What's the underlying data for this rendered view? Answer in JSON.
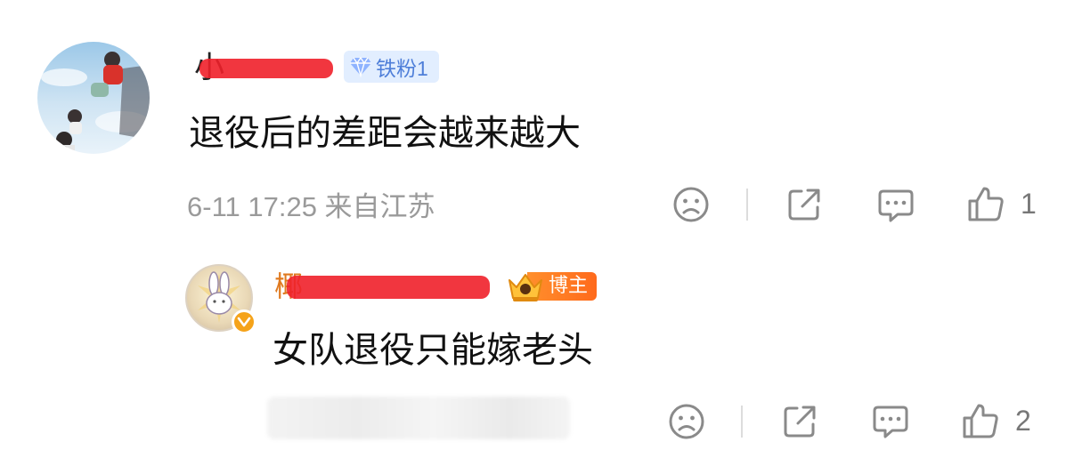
{
  "comment": {
    "username": "小",
    "fan_badge": "铁粉1",
    "content": "退役后的差距会越来越大",
    "meta": "6-11 17:25  来自江苏",
    "likes": "1"
  },
  "reply": {
    "username": "椰",
    "blogger_badge": "博主",
    "content": "女队退役只能嫁老头",
    "likes": "2"
  },
  "colors": {
    "fan_badge_bg": "#e2eeff",
    "fan_badge_text": "#4f7fd9",
    "blogger_badge": "#ff7a24",
    "redaction": "#f0202a",
    "meta_text": "#9a9a9a",
    "icon": "#8a8a8a"
  },
  "icons": {
    "dislike": "frown-face-icon",
    "share": "share-icon",
    "comment": "comment-bubble-icon",
    "like": "thumbs-up-icon",
    "fan": "diamond-icon",
    "blogger": "crown-icon",
    "verified": "verified-v-icon"
  }
}
